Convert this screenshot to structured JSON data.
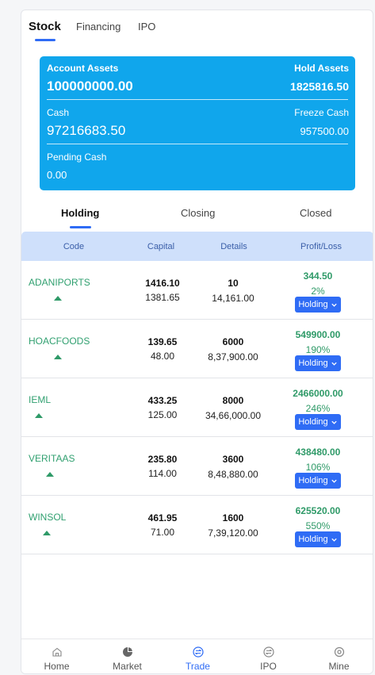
{
  "top_tabs": [
    {
      "label": "Stock",
      "active": true
    },
    {
      "label": "Financing",
      "active": false
    },
    {
      "label": "IPO",
      "active": false
    }
  ],
  "account": {
    "account_assets_label": "Account Assets",
    "account_assets_value": "100000000.00",
    "hold_assets_label": "Hold Assets",
    "hold_assets_value": "1825816.50",
    "cash_label": "Cash",
    "cash_value": "97216683.50",
    "freeze_cash_label": "Freeze Cash",
    "freeze_cash_value": "957500.00",
    "pending_cash_label": "Pending Cash",
    "pending_cash_value": "0.00"
  },
  "sub_tabs": [
    {
      "label": "Holding",
      "active": true
    },
    {
      "label": "Closing",
      "active": false
    },
    {
      "label": "Closed",
      "active": false
    }
  ],
  "table": {
    "headers": [
      "Code",
      "Capital",
      "Details",
      "Profit/Loss"
    ],
    "rows": [
      {
        "code": "ADANIPORTS",
        "capital_top": "1416.10",
        "capital_bottom": "1381.65",
        "details_top": "10",
        "details_bottom": "14,161.00",
        "pl_value": "344.50",
        "pl_percent": "2%",
        "button": "Holding"
      },
      {
        "code": "HOACFOODS",
        "capital_top": "139.65",
        "capital_bottom": "48.00",
        "details_top": "6000",
        "details_bottom": "8,37,900.00",
        "pl_value": "549900.00",
        "pl_percent": "190%",
        "button": "Holding"
      },
      {
        "code": "IEML",
        "capital_top": "433.25",
        "capital_bottom": "125.00",
        "details_top": "8000",
        "details_bottom": "34,66,000.00",
        "pl_value": "2466000.00",
        "pl_percent": "246%",
        "button": "Holding"
      },
      {
        "code": "VERITAAS",
        "capital_top": "235.80",
        "capital_bottom": "114.00",
        "details_top": "3600",
        "details_bottom": "8,48,880.00",
        "pl_value": "438480.00",
        "pl_percent": "106%",
        "button": "Holding"
      },
      {
        "code": "WINSOL",
        "capital_top": "461.95",
        "capital_bottom": "71.00",
        "details_top": "1600",
        "details_bottom": "7,39,120.00",
        "pl_value": "625520.00",
        "pl_percent": "550%",
        "button": "Holding"
      }
    ]
  },
  "bottom_nav": [
    {
      "label": "Home",
      "icon": "home-icon",
      "active": false
    },
    {
      "label": "Market",
      "icon": "pie-chart-icon",
      "active": false
    },
    {
      "label": "Trade",
      "icon": "exchange-icon",
      "active": true
    },
    {
      "label": "IPO",
      "icon": "exchange-icon",
      "active": false
    },
    {
      "label": "Mine",
      "icon": "settings-icon",
      "active": false
    }
  ],
  "colors": {
    "accent": "#2f6cf5",
    "card": "#10a6ec",
    "profit": "#2f9a68",
    "header_bg": "#cfe0fb"
  }
}
